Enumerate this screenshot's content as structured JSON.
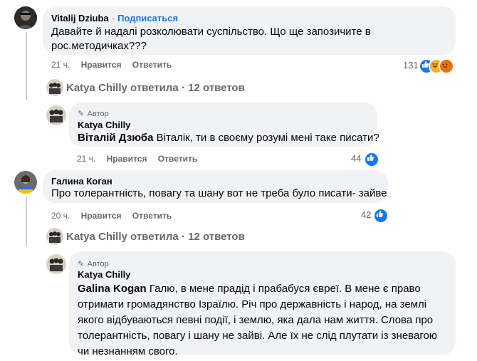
{
  "comments": [
    {
      "author": "Vitalij Dziuba",
      "follow_label": "Подписаться",
      "text": "Давайте й надалі розколювати суспільство. Що ще запозичите в рос.методичках???",
      "time": "21 ч.",
      "like_label": "Нравится",
      "reply_label": "Ответить",
      "reaction_count": "131",
      "reactions": [
        "like-icon",
        "haha-icon",
        "angry-icon"
      ]
    },
    {
      "author": "Katya Chilly",
      "replied_label": "Katya Chilly ответила · 12 ответов",
      "author_badge": "Автор",
      "mention": "Віталій Дзюба",
      "text": " Віталік, ти в своєму розумі мені таке писати?",
      "time": "21 ч.",
      "like_label": "Нравится",
      "reply_label": "Ответить",
      "reaction_count": "44",
      "reactions": [
        "like-icon"
      ]
    },
    {
      "author": "Галина Коган",
      "text": "Про толерантність, повагу та шану вот не треба було писати- зайве",
      "time": "20 ч.",
      "like_label": "Нравится",
      "reply_label": "Ответить",
      "reaction_count": "42",
      "reactions": [
        "like-icon"
      ]
    },
    {
      "author": "Katya Chilly",
      "replied_label": "Katya Chilly ответила · 12 ответов",
      "author_badge": "Автор",
      "mention": "Galina Kogan",
      "text": " Галю, в мене прадід і прабабуся євреї. В мене є право отримати громадянство Ізраїлю. Річ про державність і народ, на землі якого відбуваються певні події, і землю, яка дала нам життя. Слова про толерантність, повагу і шану не зайві. Але їх не слід плутати із зневагою чи незнанням свого."
    }
  ],
  "colors": {
    "like": "#1877f2",
    "haha": "#f7b125",
    "angry": "#e9710f",
    "bubble": "#f0f2f5",
    "meta": "#65676b"
  }
}
